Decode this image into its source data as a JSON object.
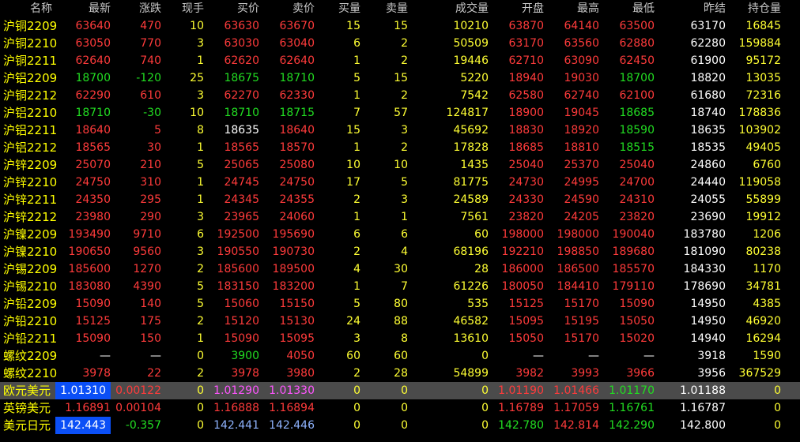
{
  "columns": [
    "名称",
    "最新",
    "涨跌",
    "现手",
    "买价",
    "卖价",
    "买量",
    "卖量",
    "成交量",
    "开盘",
    "最高",
    "最低",
    "昨结",
    "持仓量"
  ],
  "rows": [
    {
      "name": "沪铜2209",
      "last": "63640",
      "chg": "470",
      "hand": "10",
      "bid": "63630",
      "ask": "63670",
      "bidv": "15",
      "askv": "15",
      "vol": "10210",
      "open": "63870",
      "high": "64140",
      "low": "63500",
      "prev": "63170",
      "oi": "16845",
      "dir": "up"
    },
    {
      "name": "沪铜2210",
      "last": "63050",
      "chg": "770",
      "hand": "3",
      "bid": "63030",
      "ask": "63040",
      "bidv": "6",
      "askv": "2",
      "vol": "50509",
      "open": "63170",
      "high": "63560",
      "low": "62880",
      "prev": "62280",
      "oi": "159884",
      "dir": "up"
    },
    {
      "name": "沪铜2211",
      "last": "62640",
      "chg": "740",
      "hand": "1",
      "bid": "62620",
      "ask": "62640",
      "bidv": "1",
      "askv": "2",
      "vol": "19446",
      "open": "62710",
      "high": "63090",
      "low": "62450",
      "prev": "61900",
      "oi": "95172",
      "dir": "up"
    },
    {
      "name": "沪铝2209",
      "last": "18700",
      "chg": "-120",
      "hand": "25",
      "bid": "18675",
      "ask": "18710",
      "bidv": "5",
      "askv": "15",
      "vol": "5220",
      "open": "18940",
      "high": "19030",
      "low": "18700",
      "prev": "18820",
      "oi": "13035",
      "dir": "down"
    },
    {
      "name": "沪铜2212",
      "last": "62290",
      "chg": "610",
      "hand": "3",
      "bid": "62270",
      "ask": "62330",
      "bidv": "1",
      "askv": "2",
      "vol": "7542",
      "open": "62580",
      "high": "62740",
      "low": "62100",
      "prev": "61680",
      "oi": "72316",
      "dir": "up"
    },
    {
      "name": "沪铝2210",
      "last": "18710",
      "chg": "-30",
      "hand": "10",
      "bid": "18710",
      "ask": "18715",
      "bidv": "7",
      "askv": "57",
      "vol": "124817",
      "open": "18900",
      "high": "19045",
      "low": "18685",
      "prev": "18740",
      "oi": "178836",
      "dir": "down"
    },
    {
      "name": "沪铝2211",
      "last": "18640",
      "chg": "5",
      "hand": "8",
      "bid": "18635",
      "ask": "18640",
      "bidv": "15",
      "askv": "3",
      "vol": "45692",
      "open": "18830",
      "high": "18920",
      "low": "18590",
      "prev": "18635",
      "oi": "103902",
      "dir": "up"
    },
    {
      "name": "沪铝2212",
      "last": "18565",
      "chg": "30",
      "hand": "1",
      "bid": "18565",
      "ask": "18570",
      "bidv": "1",
      "askv": "2",
      "vol": "17828",
      "open": "18685",
      "high": "18810",
      "low": "18515",
      "prev": "18535",
      "oi": "49405",
      "dir": "up"
    },
    {
      "name": "沪锌2209",
      "last": "25070",
      "chg": "210",
      "hand": "5",
      "bid": "25065",
      "ask": "25080",
      "bidv": "10",
      "askv": "10",
      "vol": "1435",
      "open": "25040",
      "high": "25370",
      "low": "25040",
      "prev": "24860",
      "oi": "6760",
      "dir": "up"
    },
    {
      "name": "沪锌2210",
      "last": "24750",
      "chg": "310",
      "hand": "1",
      "bid": "24745",
      "ask": "24750",
      "bidv": "17",
      "askv": "5",
      "vol": "81775",
      "open": "24730",
      "high": "24995",
      "low": "24700",
      "prev": "24440",
      "oi": "119058",
      "dir": "up"
    },
    {
      "name": "沪锌2211",
      "last": "24350",
      "chg": "295",
      "hand": "1",
      "bid": "24345",
      "ask": "24355",
      "bidv": "2",
      "askv": "3",
      "vol": "24589",
      "open": "24330",
      "high": "24590",
      "low": "24310",
      "prev": "24055",
      "oi": "55899",
      "dir": "up"
    },
    {
      "name": "沪锌2212",
      "last": "23980",
      "chg": "290",
      "hand": "3",
      "bid": "23965",
      "ask": "24060",
      "bidv": "1",
      "askv": "1",
      "vol": "7561",
      "open": "23820",
      "high": "24205",
      "low": "23820",
      "prev": "23690",
      "oi": "19912",
      "dir": "up"
    },
    {
      "name": "沪镍2209",
      "last": "193490",
      "chg": "9710",
      "hand": "6",
      "bid": "192500",
      "ask": "195690",
      "bidv": "6",
      "askv": "6",
      "vol": "60",
      "open": "198000",
      "high": "198000",
      "low": "190040",
      "prev": "183780",
      "oi": "1206",
      "dir": "up"
    },
    {
      "name": "沪镍2210",
      "last": "190650",
      "chg": "9560",
      "hand": "3",
      "bid": "190550",
      "ask": "190730",
      "bidv": "2",
      "askv": "4",
      "vol": "68196",
      "open": "192210",
      "high": "198850",
      "low": "189680",
      "prev": "181090",
      "oi": "80238",
      "dir": "up"
    },
    {
      "name": "沪锡2209",
      "last": "185600",
      "chg": "1270",
      "hand": "2",
      "bid": "185600",
      "ask": "189500",
      "bidv": "4",
      "askv": "30",
      "vol": "28",
      "open": "186000",
      "high": "186500",
      "low": "185570",
      "prev": "184330",
      "oi": "1170",
      "dir": "up"
    },
    {
      "name": "沪锡2210",
      "last": "183080",
      "chg": "4390",
      "hand": "5",
      "bid": "183150",
      "ask": "183200",
      "bidv": "1",
      "askv": "7",
      "vol": "61226",
      "open": "180050",
      "high": "184410",
      "low": "179110",
      "prev": "178690",
      "oi": "34781",
      "dir": "up"
    },
    {
      "name": "沪铅2209",
      "last": "15090",
      "chg": "140",
      "hand": "5",
      "bid": "15060",
      "ask": "15150",
      "bidv": "5",
      "askv": "80",
      "vol": "535",
      "open": "15125",
      "high": "15170",
      "low": "15090",
      "prev": "14950",
      "oi": "4385",
      "dir": "up"
    },
    {
      "name": "沪铅2210",
      "last": "15125",
      "chg": "175",
      "hand": "2",
      "bid": "15120",
      "ask": "15130",
      "bidv": "24",
      "askv": "88",
      "vol": "46582",
      "open": "15095",
      "high": "15195",
      "low": "15050",
      "prev": "14950",
      "oi": "46920",
      "dir": "up"
    },
    {
      "name": "沪铅2211",
      "last": "15090",
      "chg": "150",
      "hand": "1",
      "bid": "15090",
      "ask": "15095",
      "bidv": "3",
      "askv": "8",
      "vol": "13610",
      "open": "15050",
      "high": "15170",
      "low": "15020",
      "prev": "14940",
      "oi": "16294",
      "dir": "up"
    },
    {
      "name": "螺纹2209",
      "last": "—",
      "chg": "—",
      "hand": "0",
      "bid": "3900",
      "ask": "4050",
      "bidv": "60",
      "askv": "60",
      "vol": "0",
      "open": "—",
      "high": "—",
      "low": "—",
      "prev": "3918",
      "oi": "1590",
      "dir": "none"
    },
    {
      "name": "螺纹2210",
      "last": "3978",
      "chg": "22",
      "hand": "2",
      "bid": "3978",
      "ask": "3980",
      "bidv": "2",
      "askv": "28",
      "vol": "54899",
      "open": "3982",
      "high": "3993",
      "low": "3966",
      "prev": "3956",
      "oi": "367529",
      "dir": "up"
    },
    {
      "name": "欧元美元",
      "last": "1.01310",
      "chg": "0.00122",
      "hand": "0",
      "bid": "1.01290",
      "ask": "1.01330",
      "bidv": "0",
      "askv": "0",
      "vol": "0",
      "open": "1.01190",
      "high": "1.01466",
      "low": "1.01170",
      "prev": "1.01188",
      "oi": "0",
      "dir": "fx1"
    },
    {
      "name": "英镑美元",
      "last": "1.16891",
      "chg": "0.00104",
      "hand": "0",
      "bid": "1.16888",
      "ask": "1.16894",
      "bidv": "0",
      "askv": "0",
      "vol": "0",
      "open": "1.16789",
      "high": "1.17059",
      "low": "1.16761",
      "prev": "1.16787",
      "oi": "0",
      "dir": "fx2"
    },
    {
      "name": "美元日元",
      "last": "142.443",
      "chg": "-0.357",
      "hand": "0",
      "bid": "142.441",
      "ask": "142.446",
      "bidv": "0",
      "askv": "0",
      "vol": "0",
      "open": "142.780",
      "high": "142.814",
      "low": "142.290",
      "prev": "142.800",
      "oi": "0",
      "dir": "fx3"
    }
  ],
  "colors": {
    "up": "#ff3b3b",
    "down": "#22dd22",
    "flat": "#ffffff",
    "name": "#ffff00",
    "volume": "#ffff33",
    "selected_bg": "#4b4b4b",
    "last_box": "#0b4ff6"
  }
}
